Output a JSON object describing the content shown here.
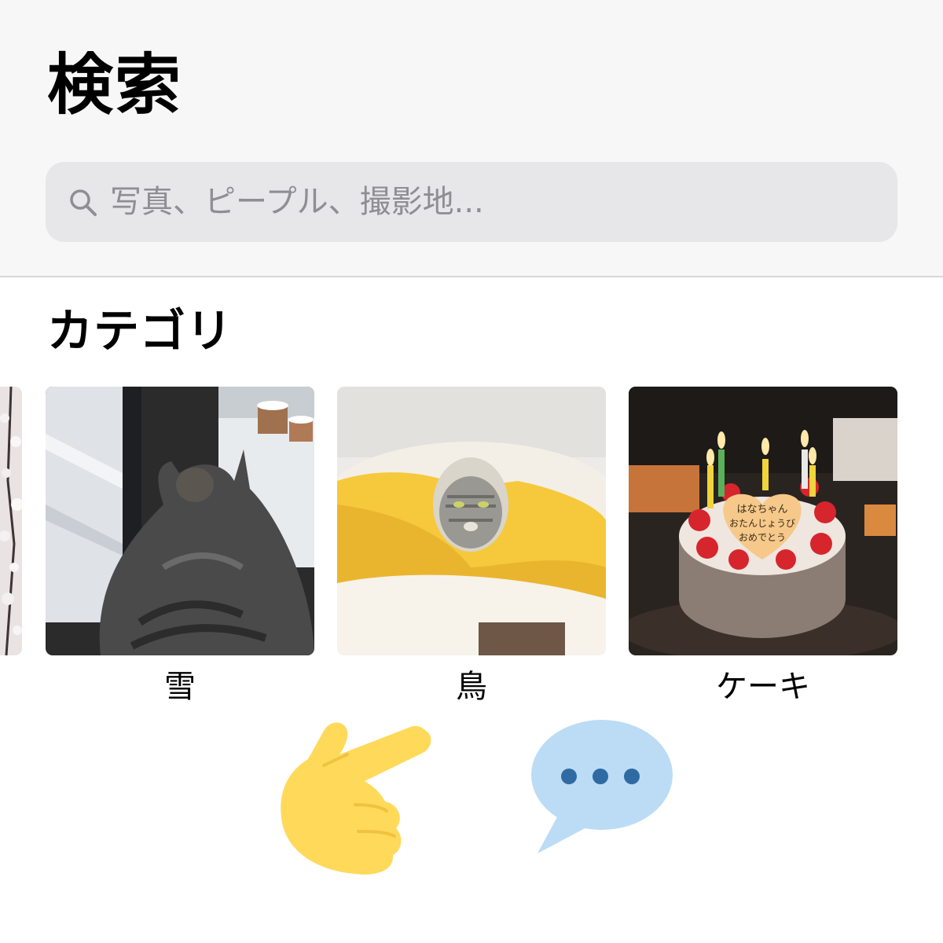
{
  "header": {
    "title": "検索",
    "search": {
      "placeholder": "写真、ピープル、撮影地..."
    }
  },
  "categories": {
    "title": "カテゴリ",
    "items": [
      {
        "label": "雪"
      },
      {
        "label": "鳥"
      },
      {
        "label": "ケーキ"
      }
    ]
  },
  "cake_message": [
    "はなちゃん",
    "おたんじょうび",
    "おめでとう"
  ],
  "icons": {
    "search": "search-icon",
    "hand": "pointing-hand-emoji",
    "speech": "speech-bubble-emoji"
  },
  "colors": {
    "header_bg": "#f7f7f8",
    "search_bg": "#e7e7ea",
    "placeholder": "#8e8e93",
    "hand": "#ffd95a",
    "speech_bubble": "#bcdcf5",
    "speech_dots": "#2f6aa3"
  }
}
